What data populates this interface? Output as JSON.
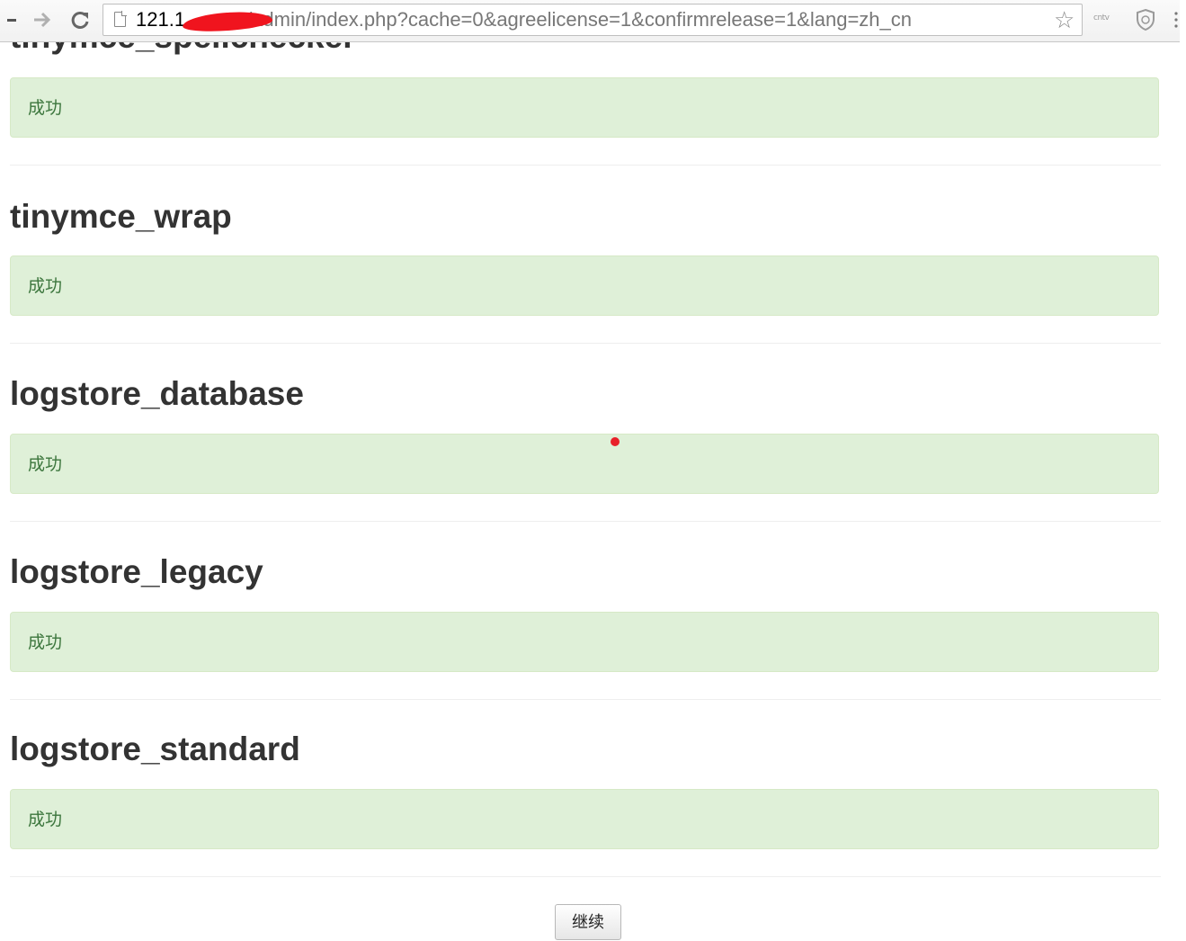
{
  "browser": {
    "nav": {
      "back_icon": "back-arrow-icon",
      "forward_icon": "forward-arrow-icon",
      "reload_icon": "reload-icon"
    },
    "url": {
      "host_visible": "121.1",
      "path": "/admin/index.php?cache=0&agreelicense=1&confirmrelease=1&lang=zh_cn"
    },
    "extension_label": "cntv"
  },
  "sections": [
    {
      "title": "tinymce_spellchecker",
      "status": "成功"
    },
    {
      "title": "tinymce_wrap",
      "status": "成功"
    },
    {
      "title": "logstore_database",
      "status": "成功"
    },
    {
      "title": "logstore_legacy",
      "status": "成功"
    },
    {
      "title": "logstore_standard",
      "status": "成功"
    }
  ],
  "continue_button": {
    "label": "继续"
  },
  "colors": {
    "success_bg": "#dff0d8",
    "success_text": "#3c763d",
    "heading": "#333333"
  }
}
